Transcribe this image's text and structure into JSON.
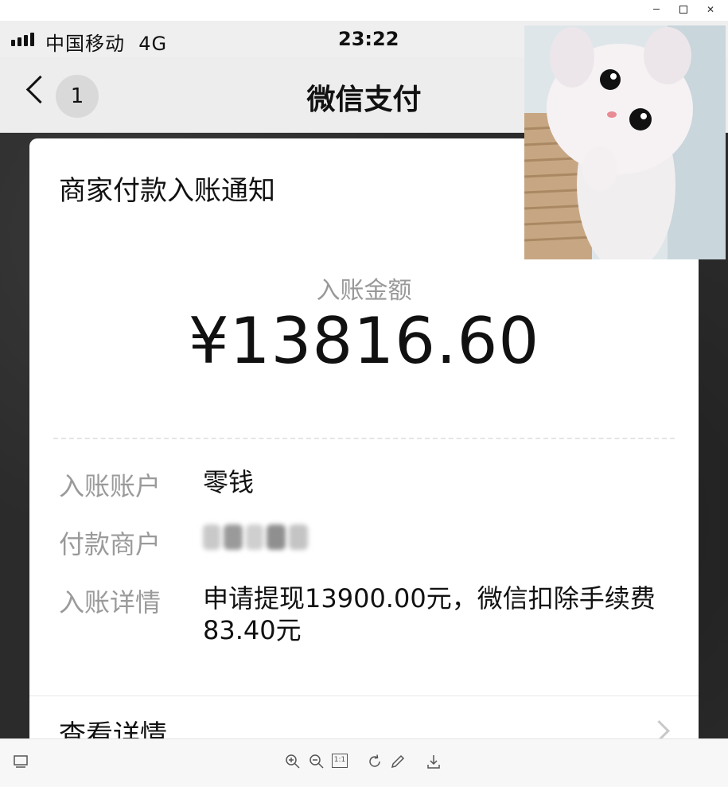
{
  "status_bar": {
    "carrier": "中国移动",
    "network": "4G",
    "time": "23:22"
  },
  "nav": {
    "back_count": "1",
    "title": "微信支付"
  },
  "card": {
    "title": "商家付款入账通知",
    "amount_label": "入账金额",
    "amount_value": "¥13816.60",
    "rows": [
      {
        "label": "入账账户",
        "value": "零钱"
      },
      {
        "label": "付款商户",
        "value": ""
      },
      {
        "label": "入账详情",
        "value": "申请提现13900.00元，微信扣除手续费83.40元"
      }
    ],
    "detail_link": "查看详情"
  },
  "toolbar": {
    "actual_size_label": "1:1"
  },
  "icons": {
    "back": "chevron-left-icon",
    "row_chevron": "chevron-right-icon",
    "zoom_in": "zoom-in-icon",
    "zoom_out": "zoom-out-icon",
    "rotate": "rotate-icon",
    "edit": "pencil-icon",
    "download": "download-icon",
    "window_min": "minimize-icon",
    "window_max": "maximize-icon",
    "window_close": "close-icon",
    "thumbnail": "thumbnail-icon"
  },
  "colors": {
    "nav_bg": "#ededed",
    "text_primary": "#111111",
    "text_secondary": "#9a9a9a",
    "card_bg": "#ffffff"
  }
}
